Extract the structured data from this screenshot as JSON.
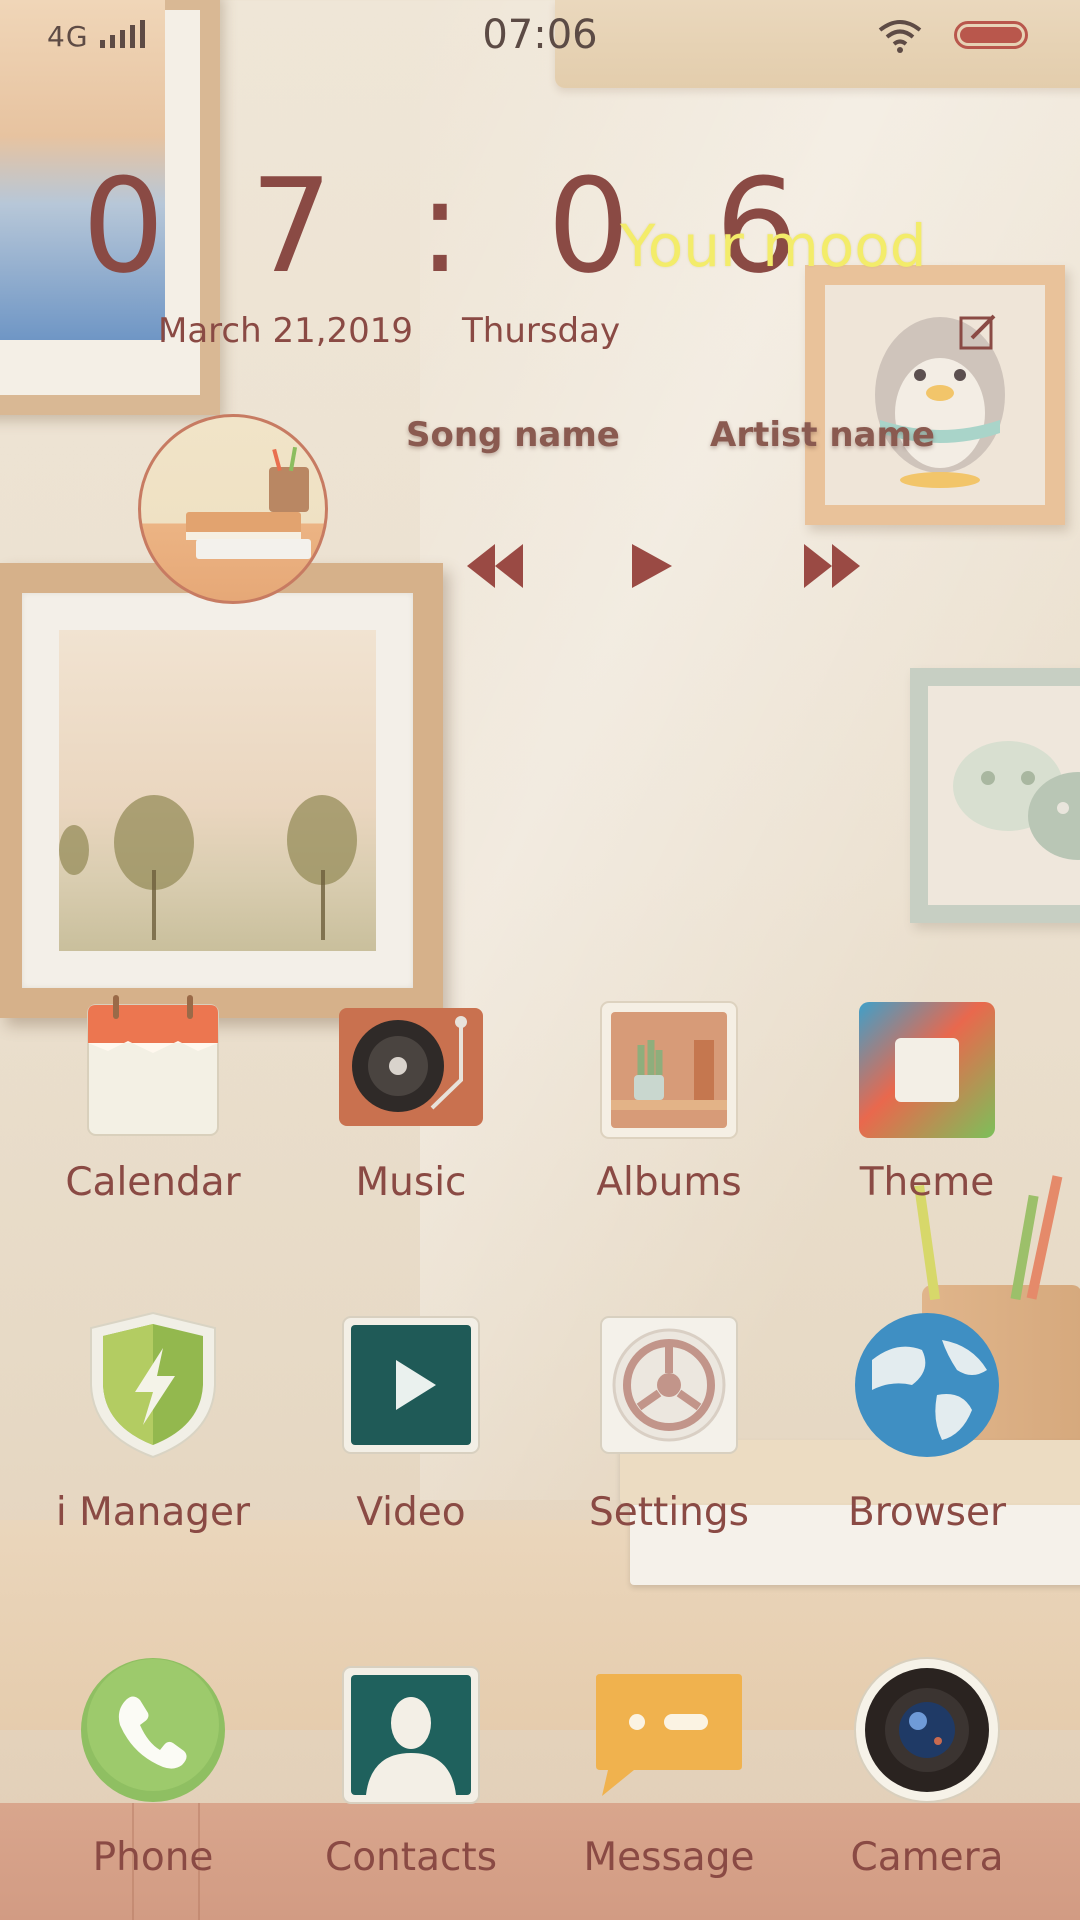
{
  "status_bar": {
    "network": "4G",
    "time": "07:06"
  },
  "clock_widget": {
    "time": "0 7 : 0 6",
    "date": "March 21,2019",
    "weekday": "Thursday",
    "mood": "Your mood"
  },
  "music_widget": {
    "song_name": "Song name",
    "artist_name": "Artist name"
  },
  "apps": [
    {
      "label": "Calendar",
      "icon": "calendar-icon"
    },
    {
      "label": "Music",
      "icon": "music-icon"
    },
    {
      "label": "Albums",
      "icon": "albums-icon"
    },
    {
      "label": "Theme",
      "icon": "theme-icon"
    },
    {
      "label": "i Manager",
      "icon": "i-manager-icon"
    },
    {
      "label": "Video",
      "icon": "video-icon"
    },
    {
      "label": "Settings",
      "icon": "settings-icon"
    },
    {
      "label": "Browser",
      "icon": "browser-icon"
    }
  ],
  "dock": [
    {
      "label": "Phone",
      "icon": "phone-icon"
    },
    {
      "label": "Contacts",
      "icon": "contacts-icon"
    },
    {
      "label": "Message",
      "icon": "message-icon"
    },
    {
      "label": "Camera",
      "icon": "camera-icon"
    }
  ],
  "colors": {
    "text_primary": "#8a4a44",
    "mood_text": "#f3ec6a",
    "battery": "#b9574c"
  }
}
